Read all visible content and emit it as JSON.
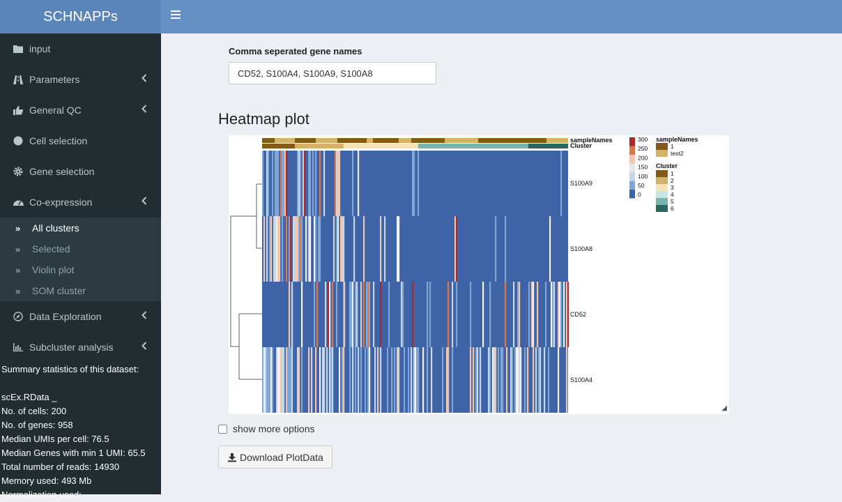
{
  "app": {
    "title": "SCHNAPPs"
  },
  "sidebar": {
    "items": [
      {
        "label": "input",
        "icon": "folder-icon",
        "chevron": false
      },
      {
        "label": "Parameters",
        "icon": "road-icon",
        "chevron": true
      },
      {
        "label": "General QC",
        "icon": "thumbs-up-icon",
        "chevron": true
      },
      {
        "label": "Cell selection",
        "icon": "circle-icon",
        "chevron": false
      },
      {
        "label": "Gene selection",
        "icon": "gear-icon",
        "chevron": false
      },
      {
        "label": "Co-expression",
        "icon": "dashboard-icon",
        "chevron": true
      }
    ],
    "submenu": [
      {
        "label": "All clusters",
        "active": true
      },
      {
        "label": "Selected",
        "active": false
      },
      {
        "label": "Violin plot",
        "active": false
      },
      {
        "label": "SOM cluster",
        "active": false
      }
    ],
    "items2": [
      {
        "label": "Data Exploration",
        "icon": "compass-icon",
        "chevron": true
      },
      {
        "label": "Subcluster analysis",
        "icon": "bar-chart-icon",
        "chevron": true
      }
    ],
    "stats": {
      "heading": "Summary statistics of this dataset:",
      "lines": [
        "scEx.RData _",
        "No. of cells: 200",
        "No. of genes: 958",
        "Median UMIs per cell: 76.5",
        "Median Genes with min 1 UMI: 65.5",
        "Total number of reads: 14930",
        "Memory used: 493 Mb",
        "Normalization used:"
      ]
    }
  },
  "main": {
    "gene_label": "Comma seperated gene names",
    "gene_value": "CD52, S100A4, S100A9, S100A8",
    "section_title": "Heatmap plot",
    "show_more": "show more options",
    "download": "Download PlotData"
  },
  "chart_data": {
    "type": "heatmap",
    "rows": [
      "S100A9",
      "S100A8",
      "CD52",
      "S100A4"
    ],
    "annotation_rows": [
      "sampleNames",
      "Cluster"
    ],
    "colorbar_ticks": [
      300,
      250,
      200,
      150,
      100,
      50,
      0
    ],
    "legends": [
      {
        "title": "sampleNames",
        "entries": [
          "1",
          "test2"
        ],
        "colors": [
          "#845a18",
          "#d4b268"
        ]
      },
      {
        "title": "Cluster",
        "entries": [
          "1",
          "2",
          "3",
          "4",
          "5",
          "6"
        ],
        "colors": [
          "#845a18",
          "#d4b268",
          "#f3e4b8",
          "#c6e6e4",
          "#7ab2ad",
          "#2d6560"
        ]
      }
    ],
    "colors": {
      "low": "#3e63a6",
      "high": "#a9292e"
    }
  }
}
